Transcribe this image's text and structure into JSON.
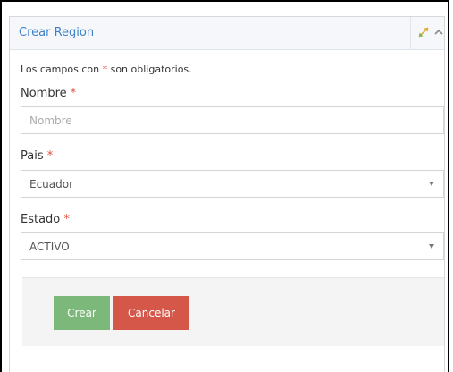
{
  "panel": {
    "title": "Crear Region"
  },
  "form": {
    "required_note_prefix": "Los campos con ",
    "required_note_star": "*",
    "required_note_suffix": " son obligatorios.",
    "fields": {
      "nombre": {
        "label": "Nombre",
        "required_mark": "*",
        "value": "",
        "placeholder": "Nombre"
      },
      "pais": {
        "label": "Pais",
        "required_mark": "*",
        "selected": "Ecuador"
      },
      "estado": {
        "label": "Estado",
        "required_mark": "*",
        "selected": "ACTIVO"
      }
    }
  },
  "actions": {
    "crear_label": "Crear",
    "cancelar_label": "Cancelar"
  },
  "colors": {
    "title": "#3e82c7",
    "required": "#e74c3c",
    "crear_button": "#7cb879",
    "cancelar_button": "#d4574a"
  },
  "icons": {
    "expand": "expand-arrows-icon",
    "collapse": "chevron-up-icon",
    "dropdown": "caret-down-icon"
  }
}
